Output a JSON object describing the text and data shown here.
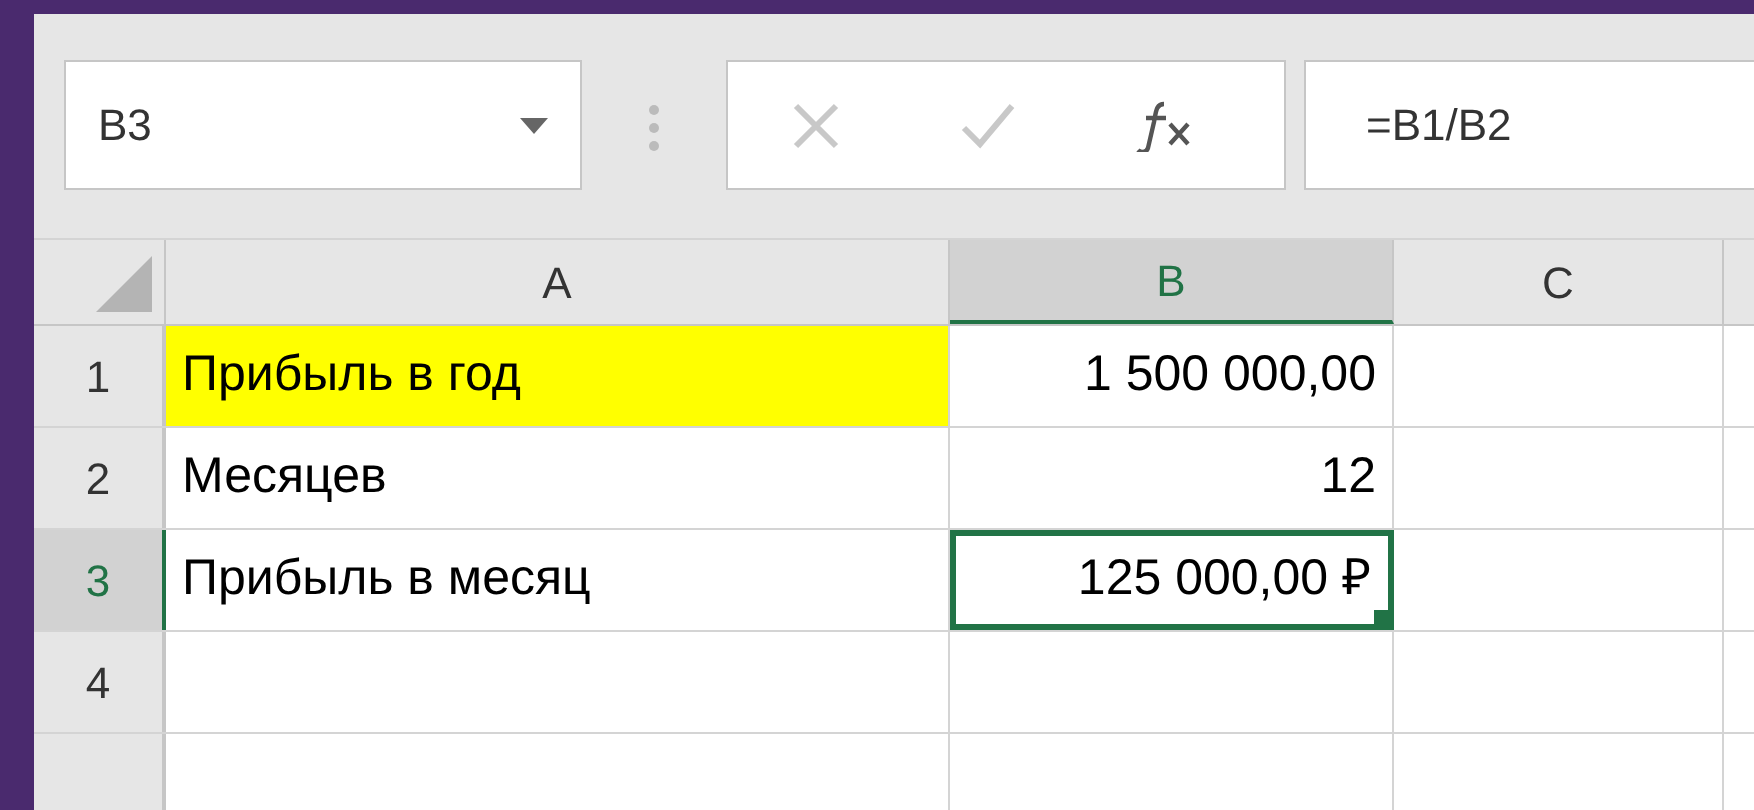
{
  "name_box": {
    "value": "B3"
  },
  "formula_bar": {
    "value": "=B1/B2"
  },
  "columns": [
    {
      "label": "A",
      "selected": false
    },
    {
      "label": "B",
      "selected": true
    },
    {
      "label": "C",
      "selected": false
    }
  ],
  "rows": [
    {
      "label": "1",
      "selected": false,
      "cells": [
        {
          "kind": "text",
          "value": "Прибыль в год",
          "color": "#ffff00",
          "selected": false
        },
        {
          "kind": "number",
          "value": "1 500 000,00",
          "selected": false
        },
        {
          "kind": "empty",
          "selected": false
        }
      ]
    },
    {
      "label": "2",
      "selected": false,
      "cells": [
        {
          "kind": "text",
          "value": "Месяцев",
          "selected": false
        },
        {
          "kind": "number",
          "value": "12",
          "selected": false
        },
        {
          "kind": "empty",
          "selected": false
        }
      ]
    },
    {
      "label": "3",
      "selected": true,
      "cells": [
        {
          "kind": "text",
          "value": "Прибыль в месяц",
          "selected": false
        },
        {
          "kind": "number",
          "value": "125 000,00 ₽",
          "selected": true
        },
        {
          "kind": "empty",
          "selected": false
        }
      ]
    },
    {
      "label": "4",
      "selected": false,
      "cells": [
        {
          "kind": "empty",
          "selected": false
        },
        {
          "kind": "empty",
          "selected": false
        },
        {
          "kind": "empty",
          "selected": false
        }
      ]
    }
  ]
}
